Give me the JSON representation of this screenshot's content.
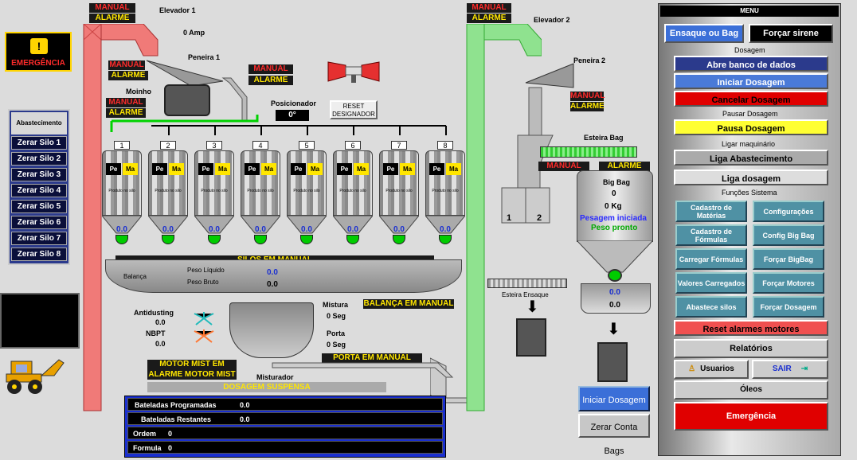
{
  "emergency": {
    "label": "EMERGÊNCIA"
  },
  "elevator1": {
    "title": "Elevador 1",
    "manual": "MANUAL",
    "alarm": "ALARME",
    "amp": "0 Amp"
  },
  "elevator2": {
    "title": "Elevador 2",
    "manual": "MANUAL",
    "alarm": "ALARME"
  },
  "peneira1": {
    "title": "Peneira 1",
    "manual": "MANUAL",
    "alarm": "ALARME"
  },
  "peneira2": {
    "title": "Peneira 2",
    "manual": "MANUAL",
    "alarm": "ALARME"
  },
  "moinho": {
    "title": "Moinho",
    "manual": "MANUAL",
    "alarm": "ALARME"
  },
  "posicionador": {
    "title": "Posicionador",
    "value": "0°"
  },
  "reset_button": "RESET DESIGNADOR",
  "abastecimento": {
    "title": "Abastecimento",
    "buttons": [
      "Zerar Silo 1",
      "Zerar Silo 2",
      "Zerar Silo 3",
      "Zerar Silo 4",
      "Zerar Silo 5",
      "Zerar Silo 6",
      "Zerar Silo 7",
      "Zerar Silo 8"
    ]
  },
  "silos": [
    {
      "num": "1",
      "pe": "Pe",
      "ma": "Ma",
      "produto": "Produto no silo",
      "v1": "0.0",
      "v2": "0.0"
    },
    {
      "num": "2",
      "pe": "Pe",
      "ma": "Ma",
      "produto": "Produto no silo",
      "v1": "0.0",
      "v2": "0.0"
    },
    {
      "num": "3",
      "pe": "Pe",
      "ma": "Ma",
      "produto": "Produto no silo",
      "v1": "0.0",
      "v2": "0.0"
    },
    {
      "num": "4",
      "pe": "Pe",
      "ma": "Ma",
      "produto": "Produto no silo",
      "v1": "0.0",
      "v2": "0.0"
    },
    {
      "num": "5",
      "pe": "Pe",
      "ma": "Ma",
      "produto": "Produto no silo",
      "v1": "0.0",
      "v2": "0.0"
    },
    {
      "num": "6",
      "pe": "Pe",
      "ma": "Ma",
      "produto": "Produto no silo",
      "v1": "0.0",
      "v2": "0.0"
    },
    {
      "num": "7",
      "pe": "Pe",
      "ma": "Ma",
      "produto": "Produto no silo",
      "v1": "0.0",
      "v2": "0.0"
    },
    {
      "num": "8",
      "pe": "Pe",
      "ma": "Ma",
      "produto": "Produto no silo",
      "v1": "0.0",
      "v2": "0.0"
    }
  ],
  "silos_manual": "SILOS EM MANUAL",
  "balanca": {
    "title": "Balança",
    "peso_liquido_label": "Peso Líquido",
    "peso_liquido": "0.0",
    "peso_bruto_label": "Peso Bruto",
    "peso_bruto": "0.0",
    "manual": "BALANÇA EM MANUAL"
  },
  "antidusting": {
    "label": "Antidusting",
    "value": "0.0"
  },
  "nbpt": {
    "label": "NBPT",
    "value": "0.0"
  },
  "mistura": {
    "label": "Mistura",
    "value": "0 Seg"
  },
  "porta": {
    "label": "Porta",
    "value": "0 Seg",
    "manual": "PORTA EM MANUAL"
  },
  "motor_mist": {
    "manual": "MOTOR MIST EM MANUAL",
    "alarm": "ALARME MOTOR MIST"
  },
  "misturador": "Misturador",
  "dosagem_suspensa": "DOSAGEM SUSPENSA",
  "bateladas": [
    {
      "label": "Bateladas Programadas",
      "value": "0.0"
    },
    {
      "label": "Bateladas Restantes",
      "value": "0.0"
    },
    {
      "label": "Ordem",
      "value": "0"
    },
    {
      "label": "Formula",
      "value": "0"
    }
  ],
  "esteira_bag": {
    "title": "Esteira Bag",
    "manual": "MANUAL",
    "alarm": "ALARME"
  },
  "bigbag": {
    "title": "Big Bag",
    "count": "0",
    "kg": "0 Kg",
    "status1": "Pesagem iniciada",
    "status2": "Peso pronto",
    "v1": "0.0",
    "v2": "0.0",
    "silo1": "1",
    "silo2": "2"
  },
  "esteira_ensaque": "Esteira Ensaque",
  "bottom_buttons": {
    "iniciar": "Iniciar Dosagem",
    "zerar_bags": "Zerar Conta Bags"
  },
  "menu": {
    "title": "MENU",
    "ensaque": "Ensaque ou Bag",
    "sirene": "Forçar sirene",
    "dosagem_head": "Dosagem",
    "abre_banco": "Abre banco de dados",
    "iniciar": "Iniciar Dosagem",
    "cancelar": "Cancelar Dosagem",
    "pausar_head": "Pausar Dosagem",
    "pausa": "Pausa Dosagem",
    "ligar_head": "Ligar maquinário",
    "liga_abast": "Liga Abastecimento",
    "liga_dos": "Liga dosagem",
    "funcoes_head": "Funções Sistema",
    "grid": [
      "Cadastro de Matérias",
      "Configurações",
      "Cadastro de Fórmulas",
      "Config Big Bag",
      "Carregar Fórmulas",
      "Forçar BigBag",
      "Valores Carregados",
      "Forçar Motores",
      "Abastece silos",
      "Forçar Dosagem"
    ],
    "reset_alarmes": "Reset alarmes motores",
    "relatorios": "Relatórios",
    "usuarios": "Usuarios",
    "sair": "SAIR",
    "oleos": "Óleos",
    "emergencia": "Emergência"
  }
}
